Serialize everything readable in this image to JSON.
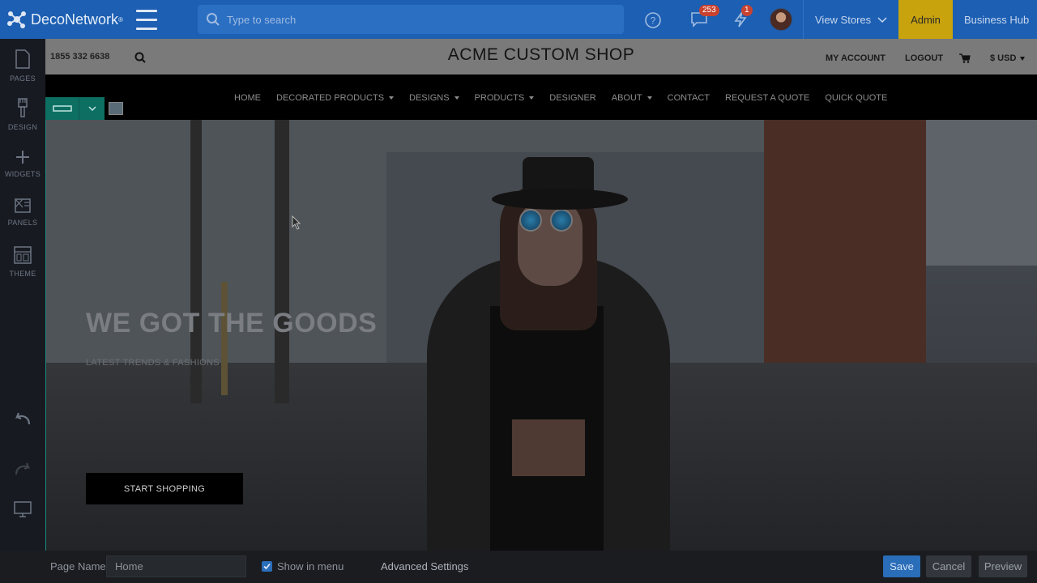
{
  "app": {
    "brand": "DecoNetwork",
    "search_placeholder": "Type to search",
    "messages_count": "253",
    "alerts_count": "1",
    "view_stores": "View Stores",
    "admin": "Admin",
    "business_hub": "Business Hub"
  },
  "sidebar": {
    "items": [
      {
        "label": "PAGES",
        "icon": "page-icon"
      },
      {
        "label": "DESIGN",
        "icon": "brush-icon"
      },
      {
        "label": "WIDGETS",
        "icon": "plus-icon"
      },
      {
        "label": "PANELS",
        "icon": "panels-icon"
      },
      {
        "label": "THEME",
        "icon": "theme-icon"
      }
    ]
  },
  "shop": {
    "phone": "1855 332 6638",
    "title": "ACME CUSTOM SHOP",
    "my_account": "MY ACCOUNT",
    "logout": "LOGOUT",
    "currency": "$ USD",
    "nav": [
      {
        "label": "HOME",
        "dropdown": false
      },
      {
        "label": "DECORATED PRODUCTS",
        "dropdown": true
      },
      {
        "label": "DESIGNS",
        "dropdown": true
      },
      {
        "label": "PRODUCTS",
        "dropdown": true
      },
      {
        "label": "DESIGNER",
        "dropdown": false
      },
      {
        "label": "ABOUT",
        "dropdown": true
      },
      {
        "label": "CONTACT",
        "dropdown": false
      },
      {
        "label": "REQUEST A QUOTE",
        "dropdown": false
      },
      {
        "label": "QUICK QUOTE",
        "dropdown": false
      }
    ],
    "hero": {
      "title": "WE GOT THE GOODS",
      "subtitle": "LATEST TRENDS & FASHIONS",
      "button": "START SHOPPING"
    }
  },
  "bottom": {
    "page_name_label": "Page Name",
    "page_name_value": "Home",
    "show_in_menu": "Show in menu",
    "advanced": "Advanced Settings",
    "save": "Save",
    "cancel": "Cancel",
    "preview": "Preview"
  },
  "colors": {
    "topbar": "#1c5fb3",
    "admin": "#c8a30e",
    "accent_teal": "#0d6e62",
    "save": "#2a6db8"
  }
}
